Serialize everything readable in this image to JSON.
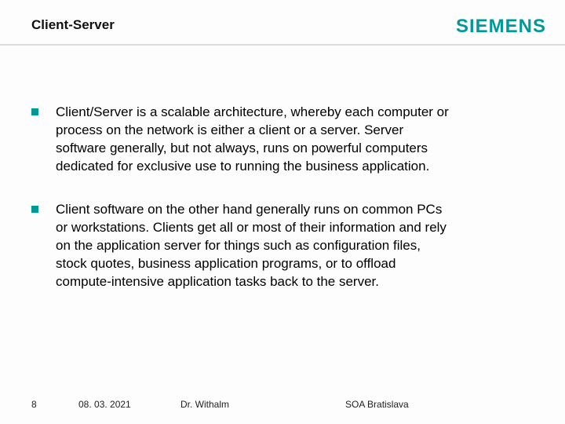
{
  "header": {
    "title": "Client-Server",
    "logo_text": "SIEMENS"
  },
  "bullets": [
    "Client/Server is a scalable architecture, whereby each computer or process on the network is either a client or a server. Server software generally, but not always, runs on powerful computers dedicated for exclusive use to running the business application.",
    "Client software on the other hand generally runs on common PCs or workstations. Clients get all or most of their information and rely on the application server for things such as configuration files, stock quotes, business application programs, or to offload compute-intensive application tasks back to the server."
  ],
  "footer": {
    "page": "8",
    "date": "08. 03. 2021",
    "author": "Dr. Withalm",
    "event": "SOA Bratislava"
  }
}
